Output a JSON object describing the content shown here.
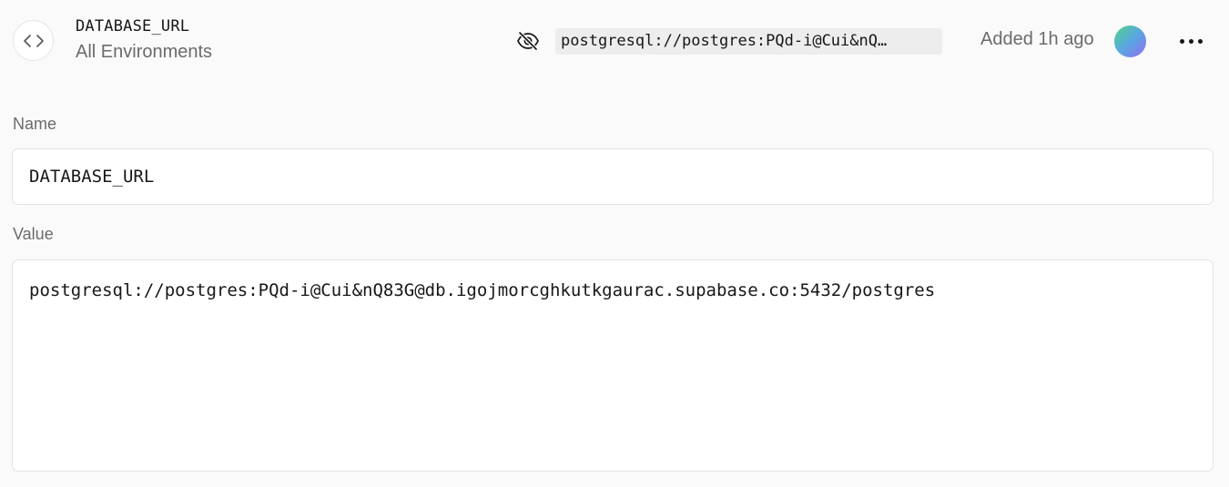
{
  "variable": {
    "name": "DATABASE_URL",
    "environment": "All Environments",
    "value_preview": "postgresql://postgres:PQd-i@Cui&nQ…",
    "added": "Added 1h ago"
  },
  "icons": {
    "code": "code-brackets-icon",
    "visibility": "eye-off-icon",
    "more": "more-horizontal-icon"
  },
  "form": {
    "name_label": "Name",
    "name_value": "DATABASE_URL",
    "value_label": "Value",
    "value_value": "postgresql://postgres:PQd-i@Cui&nQ83G@db.igojmorcghkutkgaurac.supabase.co:5432/postgres"
  },
  "colors": {
    "background": "#fafafa",
    "text_primary": "#171717",
    "text_secondary": "#6b6b6b",
    "border": "#e3e3e3",
    "preview_bg": "#ededed"
  }
}
